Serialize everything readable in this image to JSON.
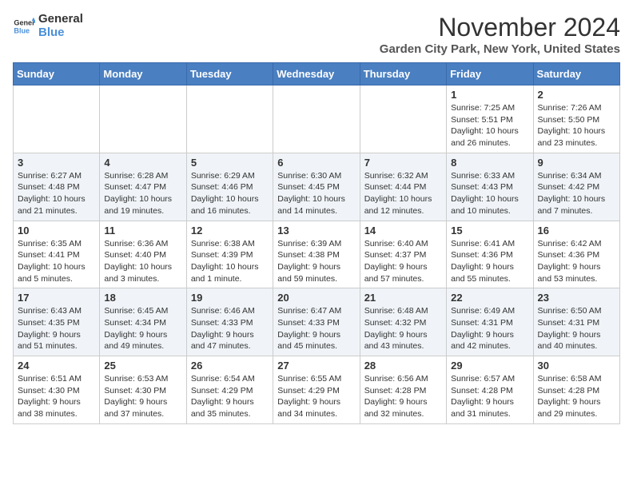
{
  "logo": {
    "general": "General",
    "blue": "Blue"
  },
  "title": "November 2024",
  "location": "Garden City Park, New York, United States",
  "days_of_week": [
    "Sunday",
    "Monday",
    "Tuesday",
    "Wednesday",
    "Thursday",
    "Friday",
    "Saturday"
  ],
  "weeks": [
    [
      {
        "day": "",
        "info": ""
      },
      {
        "day": "",
        "info": ""
      },
      {
        "day": "",
        "info": ""
      },
      {
        "day": "",
        "info": ""
      },
      {
        "day": "",
        "info": ""
      },
      {
        "day": "1",
        "info": "Sunrise: 7:25 AM\nSunset: 5:51 PM\nDaylight: 10 hours and 26 minutes."
      },
      {
        "day": "2",
        "info": "Sunrise: 7:26 AM\nSunset: 5:50 PM\nDaylight: 10 hours and 23 minutes."
      }
    ],
    [
      {
        "day": "3",
        "info": "Sunrise: 6:27 AM\nSunset: 4:48 PM\nDaylight: 10 hours and 21 minutes."
      },
      {
        "day": "4",
        "info": "Sunrise: 6:28 AM\nSunset: 4:47 PM\nDaylight: 10 hours and 19 minutes."
      },
      {
        "day": "5",
        "info": "Sunrise: 6:29 AM\nSunset: 4:46 PM\nDaylight: 10 hours and 16 minutes."
      },
      {
        "day": "6",
        "info": "Sunrise: 6:30 AM\nSunset: 4:45 PM\nDaylight: 10 hours and 14 minutes."
      },
      {
        "day": "7",
        "info": "Sunrise: 6:32 AM\nSunset: 4:44 PM\nDaylight: 10 hours and 12 minutes."
      },
      {
        "day": "8",
        "info": "Sunrise: 6:33 AM\nSunset: 4:43 PM\nDaylight: 10 hours and 10 minutes."
      },
      {
        "day": "9",
        "info": "Sunrise: 6:34 AM\nSunset: 4:42 PM\nDaylight: 10 hours and 7 minutes."
      }
    ],
    [
      {
        "day": "10",
        "info": "Sunrise: 6:35 AM\nSunset: 4:41 PM\nDaylight: 10 hours and 5 minutes."
      },
      {
        "day": "11",
        "info": "Sunrise: 6:36 AM\nSunset: 4:40 PM\nDaylight: 10 hours and 3 minutes."
      },
      {
        "day": "12",
        "info": "Sunrise: 6:38 AM\nSunset: 4:39 PM\nDaylight: 10 hours and 1 minute."
      },
      {
        "day": "13",
        "info": "Sunrise: 6:39 AM\nSunset: 4:38 PM\nDaylight: 9 hours and 59 minutes."
      },
      {
        "day": "14",
        "info": "Sunrise: 6:40 AM\nSunset: 4:37 PM\nDaylight: 9 hours and 57 minutes."
      },
      {
        "day": "15",
        "info": "Sunrise: 6:41 AM\nSunset: 4:36 PM\nDaylight: 9 hours and 55 minutes."
      },
      {
        "day": "16",
        "info": "Sunrise: 6:42 AM\nSunset: 4:36 PM\nDaylight: 9 hours and 53 minutes."
      }
    ],
    [
      {
        "day": "17",
        "info": "Sunrise: 6:43 AM\nSunset: 4:35 PM\nDaylight: 9 hours and 51 minutes."
      },
      {
        "day": "18",
        "info": "Sunrise: 6:45 AM\nSunset: 4:34 PM\nDaylight: 9 hours and 49 minutes."
      },
      {
        "day": "19",
        "info": "Sunrise: 6:46 AM\nSunset: 4:33 PM\nDaylight: 9 hours and 47 minutes."
      },
      {
        "day": "20",
        "info": "Sunrise: 6:47 AM\nSunset: 4:33 PM\nDaylight: 9 hours and 45 minutes."
      },
      {
        "day": "21",
        "info": "Sunrise: 6:48 AM\nSunset: 4:32 PM\nDaylight: 9 hours and 43 minutes."
      },
      {
        "day": "22",
        "info": "Sunrise: 6:49 AM\nSunset: 4:31 PM\nDaylight: 9 hours and 42 minutes."
      },
      {
        "day": "23",
        "info": "Sunrise: 6:50 AM\nSunset: 4:31 PM\nDaylight: 9 hours and 40 minutes."
      }
    ],
    [
      {
        "day": "24",
        "info": "Sunrise: 6:51 AM\nSunset: 4:30 PM\nDaylight: 9 hours and 38 minutes."
      },
      {
        "day": "25",
        "info": "Sunrise: 6:53 AM\nSunset: 4:30 PM\nDaylight: 9 hours and 37 minutes."
      },
      {
        "day": "26",
        "info": "Sunrise: 6:54 AM\nSunset: 4:29 PM\nDaylight: 9 hours and 35 minutes."
      },
      {
        "day": "27",
        "info": "Sunrise: 6:55 AM\nSunset: 4:29 PM\nDaylight: 9 hours and 34 minutes."
      },
      {
        "day": "28",
        "info": "Sunrise: 6:56 AM\nSunset: 4:28 PM\nDaylight: 9 hours and 32 minutes."
      },
      {
        "day": "29",
        "info": "Sunrise: 6:57 AM\nSunset: 4:28 PM\nDaylight: 9 hours and 31 minutes."
      },
      {
        "day": "30",
        "info": "Sunrise: 6:58 AM\nSunset: 4:28 PM\nDaylight: 9 hours and 29 minutes."
      }
    ]
  ]
}
